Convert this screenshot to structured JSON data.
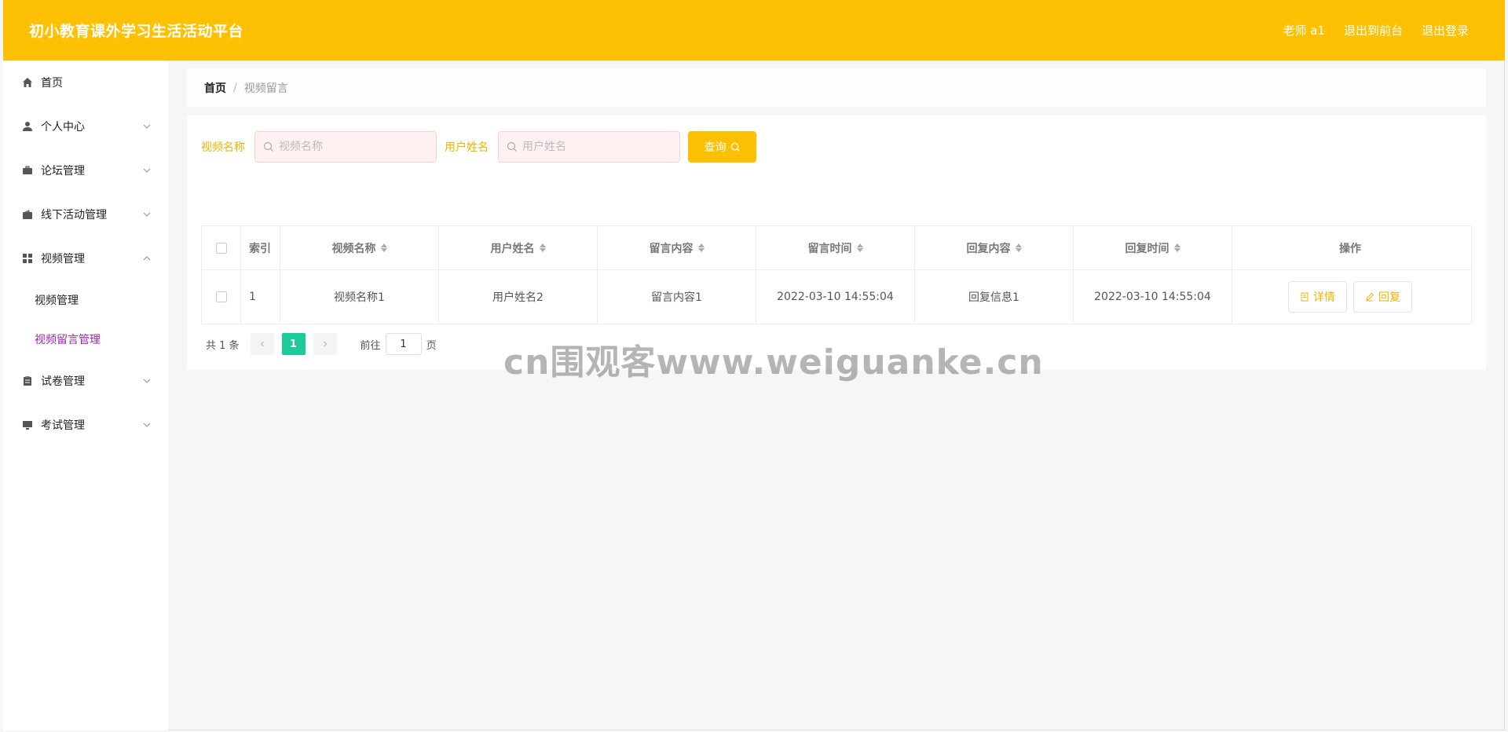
{
  "header": {
    "title": "初小教育课外学习生活活动平台",
    "user": "老师 a1",
    "back_to_front": "退出到前台",
    "logout": "退出登录"
  },
  "sidebar": {
    "items": [
      {
        "label": "首页",
        "icon": "home-icon"
      },
      {
        "label": "个人中心",
        "icon": "user-icon"
      },
      {
        "label": "论坛管理",
        "icon": "briefcase-icon"
      },
      {
        "label": "线下活动管理",
        "icon": "wallet-icon"
      },
      {
        "label": "视频管理",
        "icon": "grid-icon"
      },
      {
        "label": "试卷管理",
        "icon": "clipboard-icon"
      },
      {
        "label": "考试管理",
        "icon": "monitor-icon"
      }
    ],
    "submenu": [
      {
        "label": "视频管理"
      },
      {
        "label": "视频留言管理"
      }
    ]
  },
  "breadcrumb": {
    "home": "首页",
    "separator": "/",
    "current": "视频留言"
  },
  "search": {
    "video_label": "视频名称",
    "video_placeholder": "视频名称",
    "user_label": "用户姓名",
    "user_placeholder": "用户姓名",
    "query_label": "查询"
  },
  "table": {
    "headers": [
      "索引",
      "视频名称",
      "用户姓名",
      "留言内容",
      "留言时间",
      "回复内容",
      "回复时间",
      "操作"
    ],
    "rows": [
      {
        "index": "1",
        "video_name": "视频名称1",
        "user_name": "用户姓名2",
        "content": "留言内容1",
        "time": "2022-03-10 14:55:04",
        "reply": "回复信息1",
        "reply_time": "2022-03-10 14:55:04",
        "detail_label": "详情",
        "reply_label": "回复"
      }
    ]
  },
  "pagination": {
    "total": "共 1 条",
    "current_page": "1",
    "goto_label": "前往",
    "goto_value": "1",
    "page_unit": "页"
  },
  "watermark": "cn围观客www.weiguanke.cn",
  "colors": {
    "header": "#fec002",
    "accent": "#f0b400",
    "active_submenu": "#9c27b0",
    "page_active": "#1ec99a"
  }
}
